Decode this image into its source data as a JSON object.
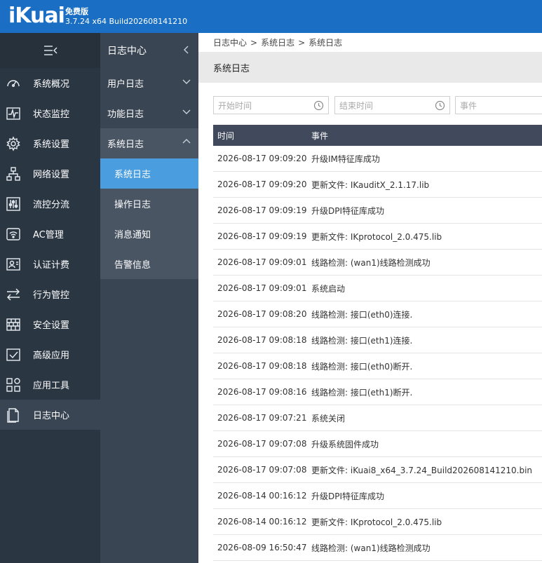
{
  "header": {
    "logo": "iKuai",
    "edition": "免费版",
    "version": "3.7.24 x64 Build202608141210"
  },
  "sidebar": {
    "items": [
      {
        "label": "系统概况",
        "icon": "dashboard-icon"
      },
      {
        "label": "状态监控",
        "icon": "monitor-icon"
      },
      {
        "label": "系统设置",
        "icon": "gear-icon"
      },
      {
        "label": "网络设置",
        "icon": "network-icon"
      },
      {
        "label": "流控分流",
        "icon": "sliders-icon"
      },
      {
        "label": "AC管理",
        "icon": "wifi-icon"
      },
      {
        "label": "认证计费",
        "icon": "id-card-icon"
      },
      {
        "label": "行为管控",
        "icon": "arrows-icon"
      },
      {
        "label": "安全设置",
        "icon": "firewall-icon"
      },
      {
        "label": "高级应用",
        "icon": "checkbox-icon"
      },
      {
        "label": "应用工具",
        "icon": "apps-icon"
      },
      {
        "label": "日志中心",
        "icon": "document-icon"
      }
    ]
  },
  "subbar": {
    "title": "日志中心",
    "groups": [
      {
        "label": "用户日志"
      },
      {
        "label": "功能日志"
      },
      {
        "label": "系统日志"
      }
    ],
    "children": [
      "系统日志",
      "操作日志",
      "消息通知",
      "告警信息"
    ]
  },
  "breadcrumb": [
    "日志中心",
    "系统日志",
    "系统日志"
  ],
  "page_title": "系统日志",
  "filters": {
    "start_placeholder": "开始时间",
    "end_placeholder": "结束时间",
    "event_placeholder": "事件"
  },
  "table": {
    "headers": [
      "时间",
      "事件"
    ],
    "rows": [
      [
        "2026-08-17 09:09:20",
        "升级IM特征库成功"
      ],
      [
        "2026-08-17 09:09:20",
        "更新文件: IKauditX_2.1.17.lib"
      ],
      [
        "2026-08-17 09:09:19",
        "升级DPI特征库成功"
      ],
      [
        "2026-08-17 09:09:19",
        "更新文件: IKprotocol_2.0.475.lib"
      ],
      [
        "2026-08-17 09:09:01",
        "线路检测: (wan1)线路检测成功"
      ],
      [
        "2026-08-17 09:09:01",
        "系统启动"
      ],
      [
        "2026-08-17 09:08:20",
        "线路检测: 接口(eth0)连接."
      ],
      [
        "2026-08-17 09:08:18",
        "线路检测: 接口(eth1)连接."
      ],
      [
        "2026-08-17 09:08:18",
        "线路检测: 接口(eth0)断开."
      ],
      [
        "2026-08-17 09:08:16",
        "线路检测: 接口(eth1)断开."
      ],
      [
        "2026-08-17 09:07:21",
        "系统关闭"
      ],
      [
        "2026-08-17 09:07:08",
        "升级系统固件成功"
      ],
      [
        "2026-08-17 09:07:08",
        "更新文件: iKuai8_x64_3.7.24_Build202608141210.bin"
      ],
      [
        "2026-08-14 00:16:12",
        "升级DPI特征库成功"
      ],
      [
        "2026-08-14 00:16:12",
        "更新文件: IKprotocol_2.0.475.lib"
      ],
      [
        "2026-08-09 16:50:47",
        "线路检测: (wan1)线路检测成功"
      ]
    ]
  },
  "colors": {
    "header": "#1a6fc4",
    "sidebar": "#2b3643",
    "subbar": "#3a4553",
    "selected": "#4a9ee0",
    "table_header": "#414a5c"
  }
}
